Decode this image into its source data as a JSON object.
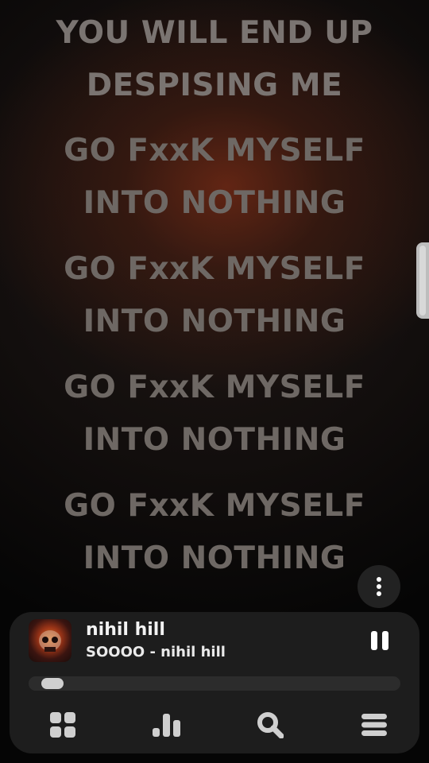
{
  "lyrics": {
    "lines": [
      "YOU WILL END UP",
      "DESPISING ME",
      "GO FxxK MYSELF",
      "INTO NOTHING",
      "GO FxxK MYSELF",
      "INTO NOTHING",
      "GO FxxK MYSELF",
      "INTO NOTHING",
      "GO FxxK MYSELF",
      "INTO NOTHING"
    ]
  },
  "player": {
    "title": "nihil hill",
    "subtitle": "SOOOO - nihil hill",
    "album_art_icon": "album-art",
    "playback_state": "playing",
    "pause_icon": "pause-icon",
    "more_icon": "more-vertical-icon",
    "progress_fraction": 0.02
  },
  "nav": {
    "items": [
      {
        "name": "home",
        "icon": "grid-icon"
      },
      {
        "name": "charts",
        "icon": "bar-chart-icon"
      },
      {
        "name": "search",
        "icon": "search-icon"
      },
      {
        "name": "queue",
        "icon": "menu-icon"
      }
    ]
  },
  "colors": {
    "lyric_text": "#7a7471",
    "player_bg": "#1d1d1d",
    "accent_glow": "#6e2814"
  }
}
